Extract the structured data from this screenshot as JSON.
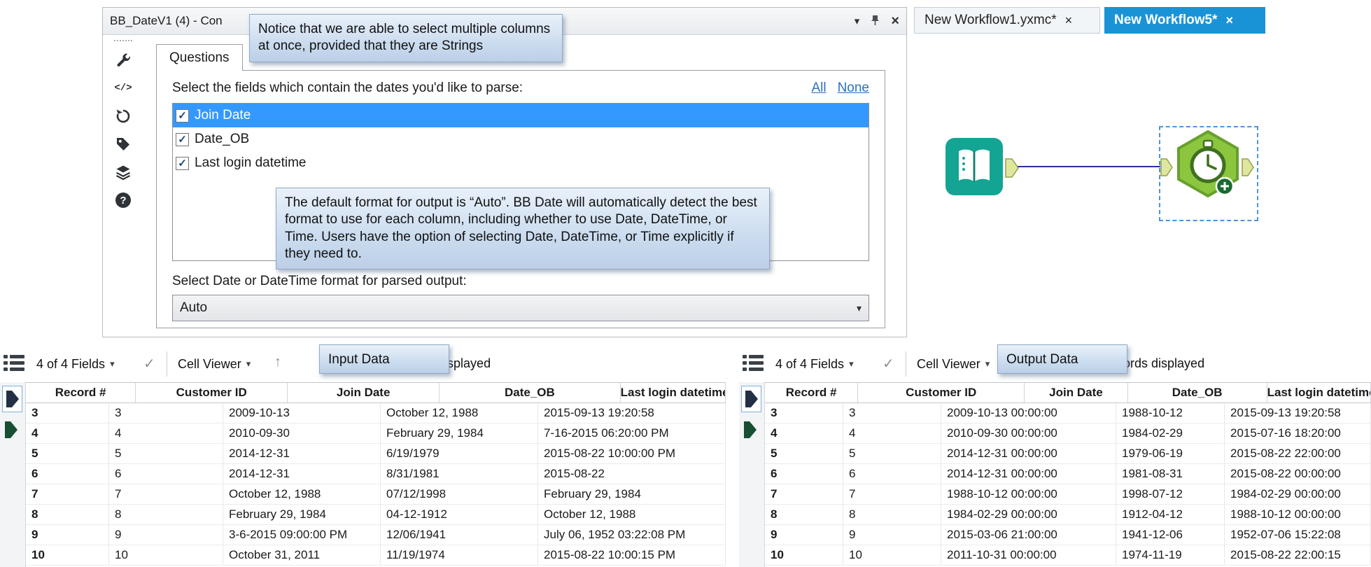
{
  "icons": {
    "chevron_down": "▾",
    "close": "×",
    "check": "✓",
    "up_arrow": "↑",
    "code": "</>",
    "question": "?"
  },
  "config": {
    "title": "BB_DateV1 (4) - Con",
    "tab_label": "Questions",
    "fields_prompt": "Select the fields which contain the dates you'd like to parse:",
    "all_label": "All",
    "none_label": "None",
    "fields": [
      {
        "label": "Join Date",
        "checked": true,
        "selected": true
      },
      {
        "label": "Date_OB",
        "checked": true,
        "selected": false
      },
      {
        "label": "Last login datetime",
        "checked": true,
        "selected": false
      }
    ],
    "format_prompt": "Select Date or DateTime format for parsed output:",
    "format_value": "Auto"
  },
  "callouts": {
    "select_note": "Notice that we are able to select multiple columns at once, provided that they are Strings",
    "format_note": "The default format for output is “Auto”.  BB Date will automatically detect the best format to use for each column, including whether to use Date, DateTime, or Time.  Users have the option of selecting Date, DateTime, or Time explicitly if they need to.",
    "input_label": "Input Data",
    "output_label": "Output Data"
  },
  "workflow": {
    "tabs": [
      {
        "label": "New Workflow1.yxmc*"
      },
      {
        "label": "New Workflow5*"
      }
    ]
  },
  "results": {
    "fields_dropdown": "4 of 4 Fields",
    "cell_viewer": "Cell Viewer",
    "records_text": "records displayed",
    "columns": [
      "Record #",
      "Customer ID",
      "Join Date",
      "Date_OB",
      "Last login datetime"
    ]
  },
  "input_rows": [
    [
      "3",
      "3",
      "2009-10-13",
      "October 12, 1988",
      "2015-09-13 19:20:58"
    ],
    [
      "4",
      "4",
      "2010-09-30",
      "February 29, 1984",
      "7-16-2015 06:20:00 PM"
    ],
    [
      "5",
      "5",
      "2014-12-31",
      "6/19/1979",
      "2015-08-22 10:00:00 PM"
    ],
    [
      "6",
      "6",
      "2014-12-31",
      "8/31/1981",
      "2015-08-22"
    ],
    [
      "7",
      "7",
      "October 12, 1988",
      "07/12/1998",
      "February 29, 1984"
    ],
    [
      "8",
      "8",
      "February 29, 1984",
      "04-12-1912",
      "October 12, 1988"
    ],
    [
      "9",
      "9",
      "3-6-2015 09:00:00 PM",
      "12/06/1941",
      "July 06, 1952 03:22:08 PM"
    ],
    [
      "10",
      "10",
      "October 31, 2011",
      "11/19/1974",
      "2015-08-22 10:00:15 PM"
    ]
  ],
  "output_rows": [
    [
      "3",
      "3",
      "2009-10-13 00:00:00",
      "1988-10-12",
      "2015-09-13 19:20:58"
    ],
    [
      "4",
      "4",
      "2010-09-30 00:00:00",
      "1984-02-29",
      "2015-07-16 18:20:00"
    ],
    [
      "5",
      "5",
      "2014-12-31 00:00:00",
      "1979-06-19",
      "2015-08-22 22:00:00"
    ],
    [
      "6",
      "6",
      "2014-12-31 00:00:00",
      "1981-08-31",
      "2015-08-22 00:00:00"
    ],
    [
      "7",
      "7",
      "1988-10-12 00:00:00",
      "1998-07-12",
      "1984-02-29 00:00:00"
    ],
    [
      "8",
      "8",
      "1984-02-29 00:00:00",
      "1912-04-12",
      "1988-10-12 00:00:00"
    ],
    [
      "9",
      "9",
      "2015-03-06 21:00:00",
      "1941-12-06",
      "1952-07-06 15:22:08"
    ],
    [
      "10",
      "10",
      "2011-10-31 00:00:00",
      "1974-11-19",
      "2015-08-22 22:00:15"
    ]
  ]
}
